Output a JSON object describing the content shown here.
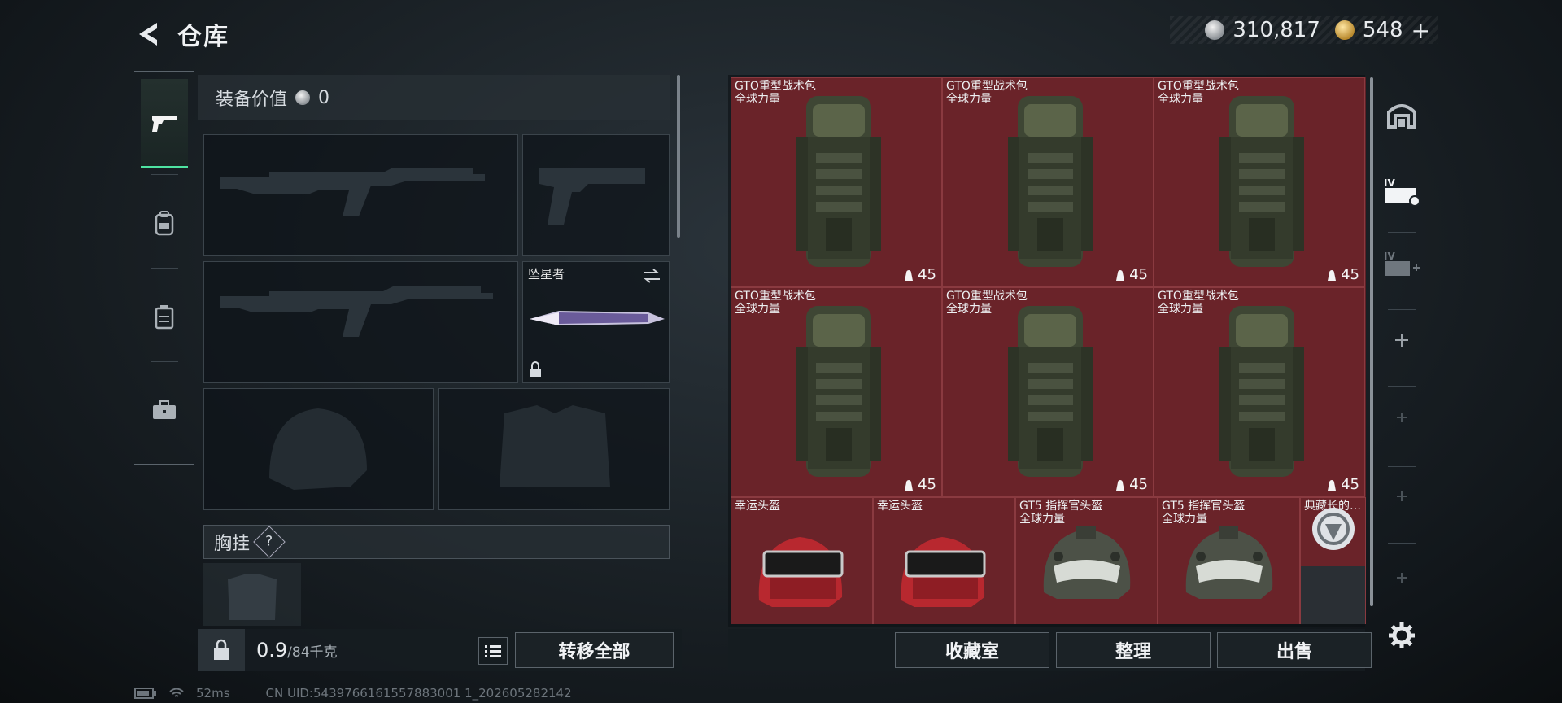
{
  "header": {
    "title": "仓库",
    "currency_silver": "310,817",
    "currency_gold": "548",
    "add_symbol": "+"
  },
  "equipment": {
    "value_label": "装备价值",
    "value": "0",
    "melee_name": "坠星者",
    "chest_label": "胸挂",
    "chest_help": "?",
    "weight_value": "0.9",
    "weight_max": "/84千克",
    "transfer_all_label": "转移全部"
  },
  "warehouse": {
    "backpacks": [
      {
        "name": "GTO重型战术包",
        "sub": "全球力量",
        "capacity": "45"
      },
      {
        "name": "GTO重型战术包",
        "sub": "全球力量",
        "capacity": "45"
      },
      {
        "name": "GTO重型战术包",
        "sub": "全球力量",
        "capacity": "45"
      },
      {
        "name": "GTO重型战术包",
        "sub": "全球力量",
        "capacity": "45"
      },
      {
        "name": "GTO重型战术包",
        "sub": "全球力量",
        "capacity": "45"
      },
      {
        "name": "GTO重型战术包",
        "sub": "全球力量",
        "capacity": "45"
      }
    ],
    "helmets": [
      {
        "name": "幸运头盔",
        "sub": ""
      },
      {
        "name": "幸运头盔",
        "sub": ""
      },
      {
        "name": "GT5 指挥官头盔",
        "sub": "全球力量"
      },
      {
        "name": "GT5 指挥官头盔",
        "sub": "全球力量"
      }
    ],
    "extra_item": "典藏长的…",
    "collection_label": "收藏室",
    "sort_label": "整理",
    "sell_label": "出售"
  },
  "right_column": {
    "tab_iv_label": "IV",
    "tab_iv_plus_label": "IV"
  },
  "status": {
    "ping": "52ms",
    "uid": "CN UID:5439766161557883001 1_202605282142"
  },
  "colors": {
    "accent": "#4ee3a1",
    "warehouse_red": "#6a2329"
  }
}
